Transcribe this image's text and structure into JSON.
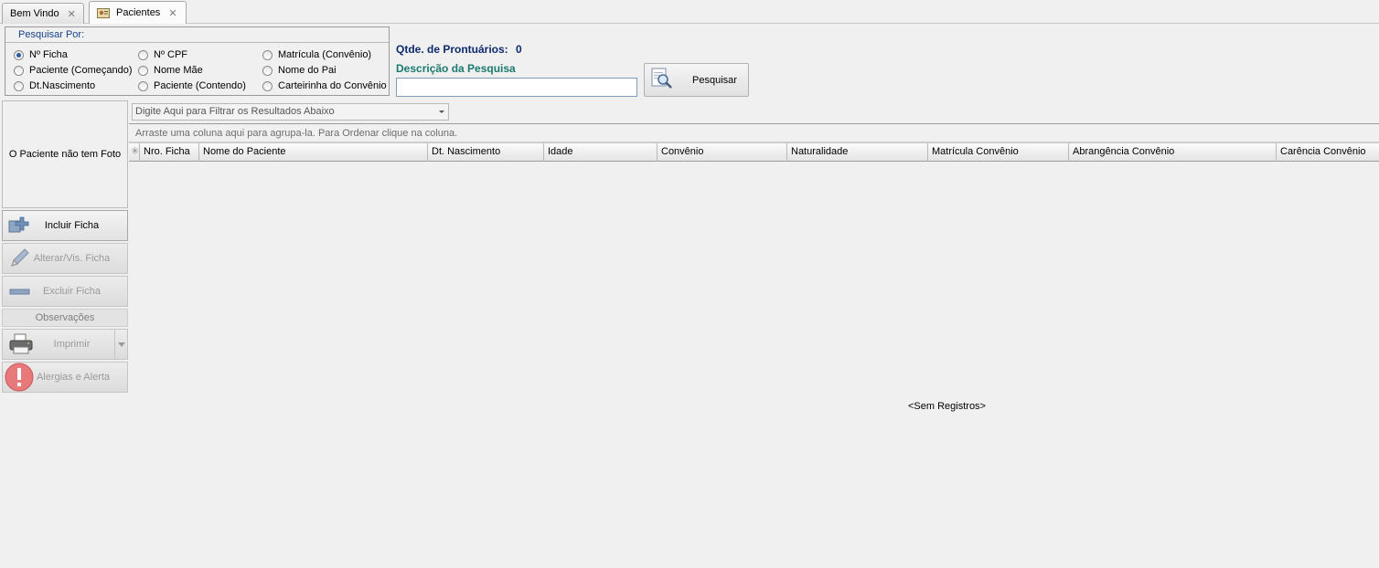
{
  "tabs": [
    {
      "label": "Bem Vindo",
      "close": "✕"
    },
    {
      "label": "Pacientes",
      "close": "✕"
    }
  ],
  "search": {
    "group_title": "Pesquisar Por:",
    "options": [
      {
        "label": "Nº Ficha",
        "selected": true
      },
      {
        "label": "Nº CPF",
        "selected": false
      },
      {
        "label": "Matrícula (Convênio)",
        "selected": false
      },
      {
        "label": "Paciente (Começando)",
        "selected": false
      },
      {
        "label": "Nome Mãe",
        "selected": false
      },
      {
        "label": "Nome do Pai",
        "selected": false
      },
      {
        "label": "Dt.Nascimento",
        "selected": false
      },
      {
        "label": "Paciente (Contendo)",
        "selected": false
      },
      {
        "label": "Carteirinha do Convênio",
        "selected": false
      }
    ],
    "qtde_label": "Qtde. de Prontuários:",
    "qtde_value": "0",
    "desc_label": "Descrição da Pesquisa",
    "desc_value": "",
    "button_label": "Pesquisar"
  },
  "photo_text": "O Paciente não tem Foto",
  "side_buttons": {
    "incluir": "Incluir Ficha",
    "alterar": "Alterar/Vis. Ficha",
    "excluir": "Excluir Ficha",
    "observacoes": "Observações",
    "imprimir": "Imprimir",
    "alergias": "Alergias e Alerta"
  },
  "filter_placeholder": "Digite Aqui para Filtrar os Resultados Abaixo",
  "grid": {
    "grouping_hint": "Arraste uma coluna aqui para agrupa-la. Para Ordenar clique na coluna.",
    "row_indicator": "✳",
    "columns": [
      "Nro. Ficha",
      "Nome do Paciente",
      "Dt. Nascimento",
      "Idade",
      "Convênio",
      "Naturalidade",
      "Matrícula Convênio",
      "Abrangência Convênio",
      "Carência Convênio"
    ],
    "empty_text": "<Sem Registros>"
  },
  "colors": {
    "group_title": "#15428b",
    "qtde_text": "#0d2a6b",
    "desc_text": "#1a7a6e",
    "alert_red": "#e05555"
  }
}
